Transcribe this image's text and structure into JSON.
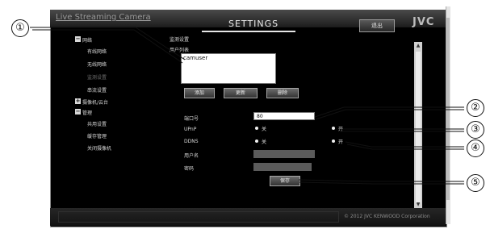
{
  "app": {
    "title": "Live Streaming Camera",
    "page_title": "SETTINGS",
    "logout_label": "退出",
    "brand": "JVC",
    "copyright": "© 2012 JVC KENWOOD Corporation"
  },
  "sidebar": {
    "network_group": "网络",
    "network_items": [
      "有线网络",
      "无线网络",
      "监测设置",
      "串流设置"
    ],
    "camera_group": "摄像机/云台",
    "manage_group": "管理",
    "manage_items": [
      "共用设置",
      "缓存管理",
      "关闭摄像机"
    ]
  },
  "panel": {
    "section_title": "监测设置",
    "user_list_label": "用户列表",
    "users": [
      "camuser"
    ],
    "add_label": "添加",
    "change_label": "更新",
    "delete_label": "删除",
    "port_label": "端口号",
    "port_value": "80",
    "upnp_label": "UPnP",
    "ddns_label": "DDNS",
    "off_label": "关",
    "on_label": "开",
    "username_label": "用户名",
    "password_label": "密码",
    "save_label": "保存"
  },
  "callouts": [
    "①",
    "②",
    "③",
    "④",
    "⑤"
  ],
  "colors": {
    "app_background": "#000000",
    "input_background": "#ffffff",
    "disabled_input": "#5b5b5b",
    "button_border": "#a6a6a6"
  }
}
